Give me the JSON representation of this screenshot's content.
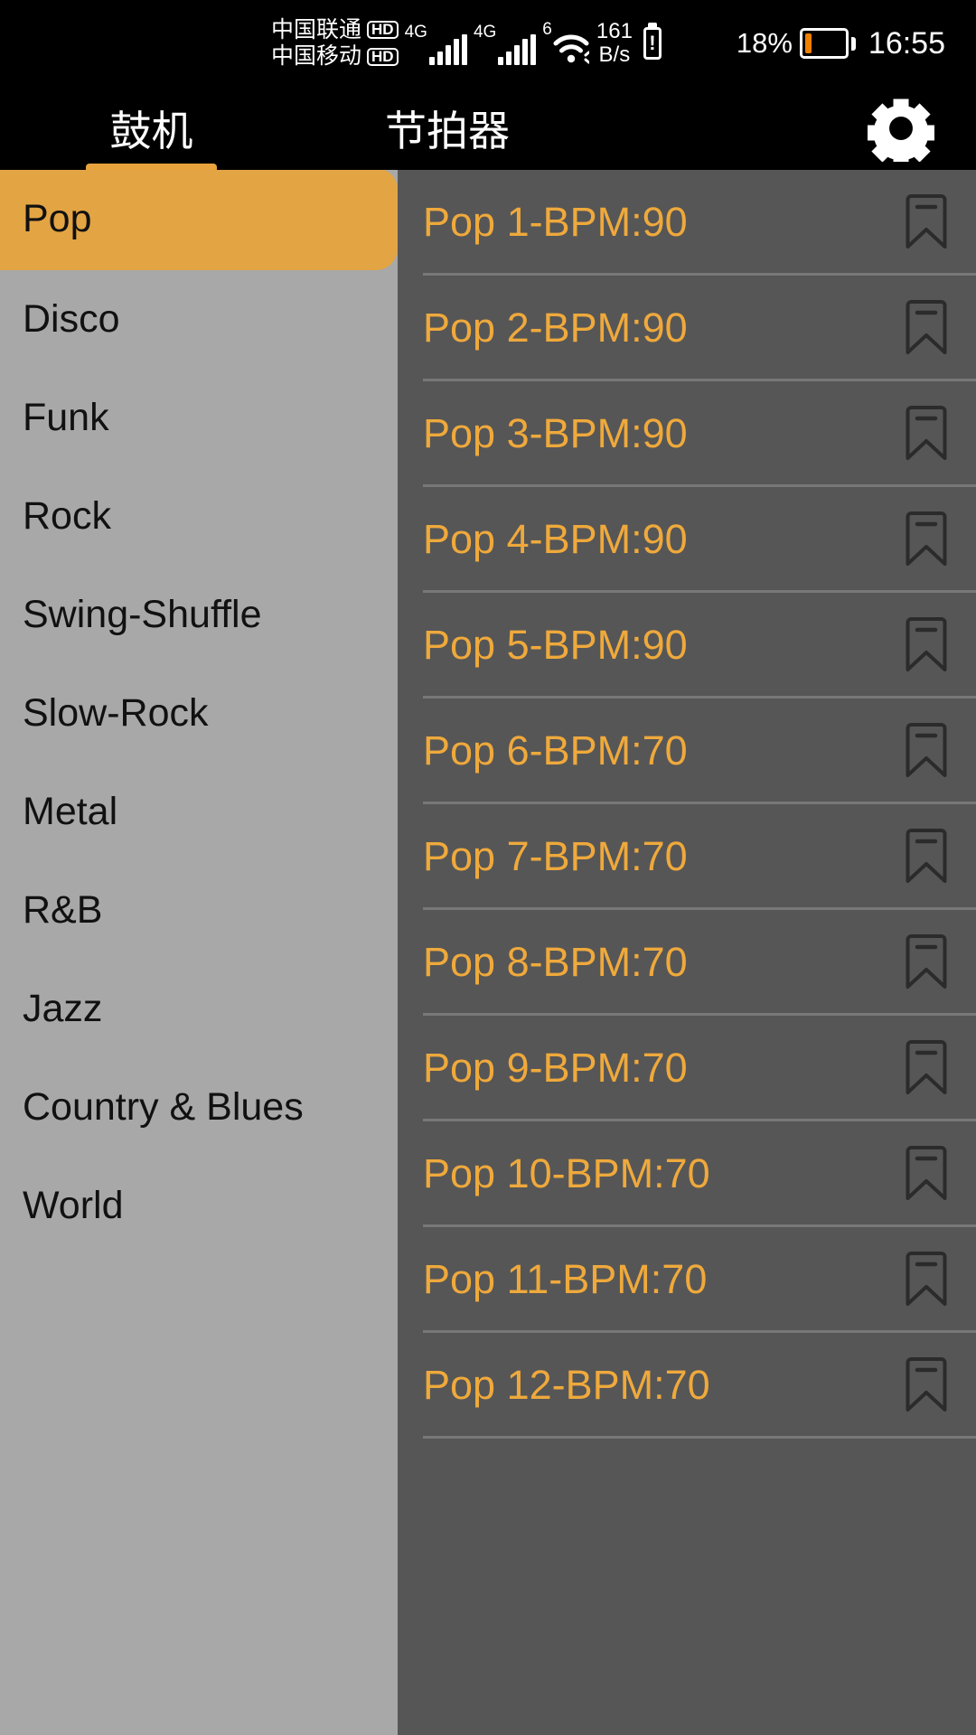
{
  "status_bar": {
    "carriers": [
      {
        "name": "中国联通",
        "badge": "HD"
      },
      {
        "name": "中国移动",
        "badge": "HD"
      }
    ],
    "signals": [
      {
        "label": "4G",
        "icon": "signal-bars-icon"
      },
      {
        "label": "4G",
        "icon": "signal-bars-icon"
      }
    ],
    "wifi": {
      "label": "6",
      "icon": "wifi-icon"
    },
    "network_speed": {
      "value": "161",
      "unit": "B/s"
    },
    "battery_alert_icon": "battery-alert-icon",
    "battery_percent": "18%",
    "battery_fill_ratio": 0.18,
    "battery_color": "#F08000",
    "clock": "16:55"
  },
  "tabs": {
    "items": [
      {
        "label": "鼓机",
        "active": true
      },
      {
        "label": "节拍器",
        "active": false
      }
    ],
    "settings_icon": "gear-icon",
    "accent_color": "#E8A33D"
  },
  "sidebar": {
    "background_color": "#A8A8A8",
    "selected_color": "#E3A443",
    "items": [
      {
        "label": "Pop",
        "selected": true
      },
      {
        "label": "Disco",
        "selected": false
      },
      {
        "label": "Funk",
        "selected": false
      },
      {
        "label": "Rock",
        "selected": false
      },
      {
        "label": "Swing-Shuffle",
        "selected": false
      },
      {
        "label": "Slow-Rock",
        "selected": false
      },
      {
        "label": "Metal",
        "selected": false
      },
      {
        "label": "R&B",
        "selected": false
      },
      {
        "label": "Jazz",
        "selected": false
      },
      {
        "label": "Country & Blues",
        "selected": false
      },
      {
        "label": "World",
        "selected": false
      }
    ]
  },
  "pattern_list": {
    "background_color": "#565656",
    "text_color": "#EFA93C",
    "divider_color": "#787878",
    "bookmark_icon": "bookmark-icon",
    "rows": [
      {
        "label": "Pop 1-BPM:90",
        "name": "Pop 1",
        "bpm": 90
      },
      {
        "label": "Pop 2-BPM:90",
        "name": "Pop 2",
        "bpm": 90
      },
      {
        "label": "Pop 3-BPM:90",
        "name": "Pop 3",
        "bpm": 90
      },
      {
        "label": "Pop 4-BPM:90",
        "name": "Pop 4",
        "bpm": 90
      },
      {
        "label": "Pop 5-BPM:90",
        "name": "Pop 5",
        "bpm": 90
      },
      {
        "label": "Pop 6-BPM:70",
        "name": "Pop 6",
        "bpm": 70
      },
      {
        "label": "Pop 7-BPM:70",
        "name": "Pop 7",
        "bpm": 70
      },
      {
        "label": "Pop 8-BPM:70",
        "name": "Pop 8",
        "bpm": 70
      },
      {
        "label": "Pop 9-BPM:70",
        "name": "Pop 9",
        "bpm": 70
      },
      {
        "label": "Pop 10-BPM:70",
        "name": "Pop 10",
        "bpm": 70
      },
      {
        "label": "Pop 11-BPM:70",
        "name": "Pop 11",
        "bpm": 70
      },
      {
        "label": "Pop 12-BPM:70",
        "name": "Pop 12",
        "bpm": 70
      }
    ]
  }
}
